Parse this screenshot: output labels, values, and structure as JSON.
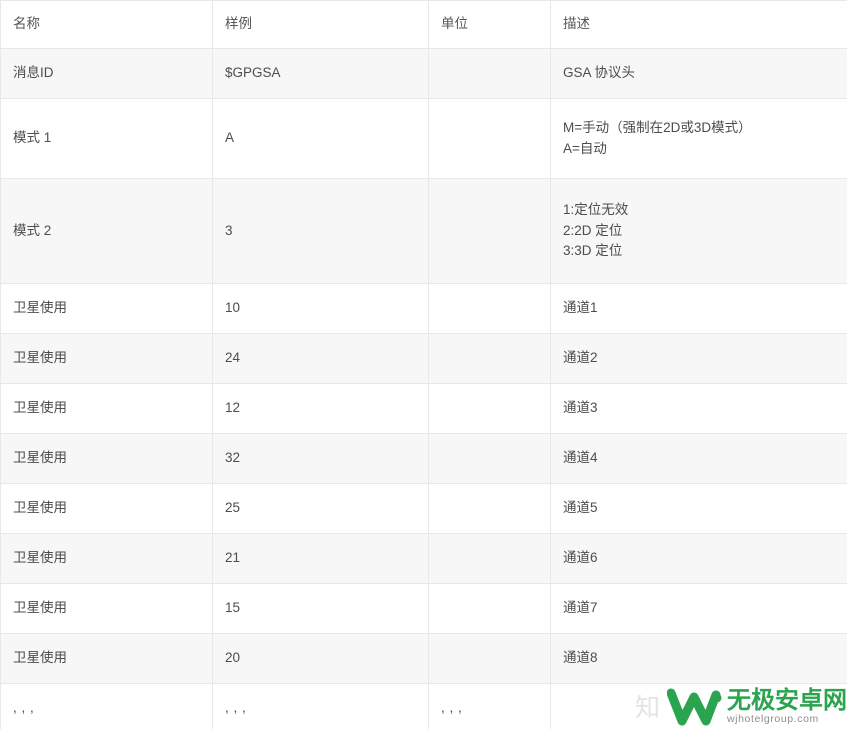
{
  "table": {
    "columns": [
      {
        "key": "name",
        "label": "名称"
      },
      {
        "key": "demo",
        "label": "样例"
      },
      {
        "key": "unit",
        "label": "单位"
      },
      {
        "key": "desc",
        "label": "描述"
      }
    ],
    "rows": [
      {
        "name": "消息ID",
        "demo": "$GPGSA",
        "unit": "",
        "desc_lines": [
          "GSA 协议头"
        ]
      },
      {
        "name": "模式 1",
        "demo": "A",
        "unit": "",
        "desc_lines": [
          "M=手动（强制在2D或3D模式）",
          "A=自动"
        ]
      },
      {
        "name": "模式 2",
        "demo": "3",
        "unit": "",
        "desc_lines": [
          "1:定位无效",
          "2:2D 定位",
          "3:3D 定位"
        ]
      },
      {
        "name": "卫星使用",
        "demo": "10",
        "unit": "",
        "desc_lines": [
          "通道1"
        ]
      },
      {
        "name": "卫星使用",
        "demo": "24",
        "unit": "",
        "desc_lines": [
          "通道2"
        ]
      },
      {
        "name": "卫星使用",
        "demo": "12",
        "unit": "",
        "desc_lines": [
          "通道3"
        ]
      },
      {
        "name": "卫星使用",
        "demo": "32",
        "unit": "",
        "desc_lines": [
          "通道4"
        ]
      },
      {
        "name": "卫星使用",
        "demo": "25",
        "unit": "",
        "desc_lines": [
          "通道5"
        ]
      },
      {
        "name": "卫星使用",
        "demo": "21",
        "unit": "",
        "desc_lines": [
          "通道6"
        ]
      },
      {
        "name": "卫星使用",
        "demo": "15",
        "unit": "",
        "desc_lines": [
          "通道7"
        ]
      },
      {
        "name": "卫星使用",
        "demo": "20",
        "unit": "",
        "desc_lines": [
          "通道8"
        ]
      },
      {
        "name": ", , ,",
        "demo": ", , ,",
        "unit": ", , ,",
        "desc_lines": [
          ""
        ]
      }
    ]
  },
  "watermark": {
    "zhihu_mark": "知",
    "logo_icon": "w-logo-icon",
    "brand": "无极安卓网",
    "url": "wjhotelgroup.com",
    "brand_color": "#2aa44f"
  }
}
